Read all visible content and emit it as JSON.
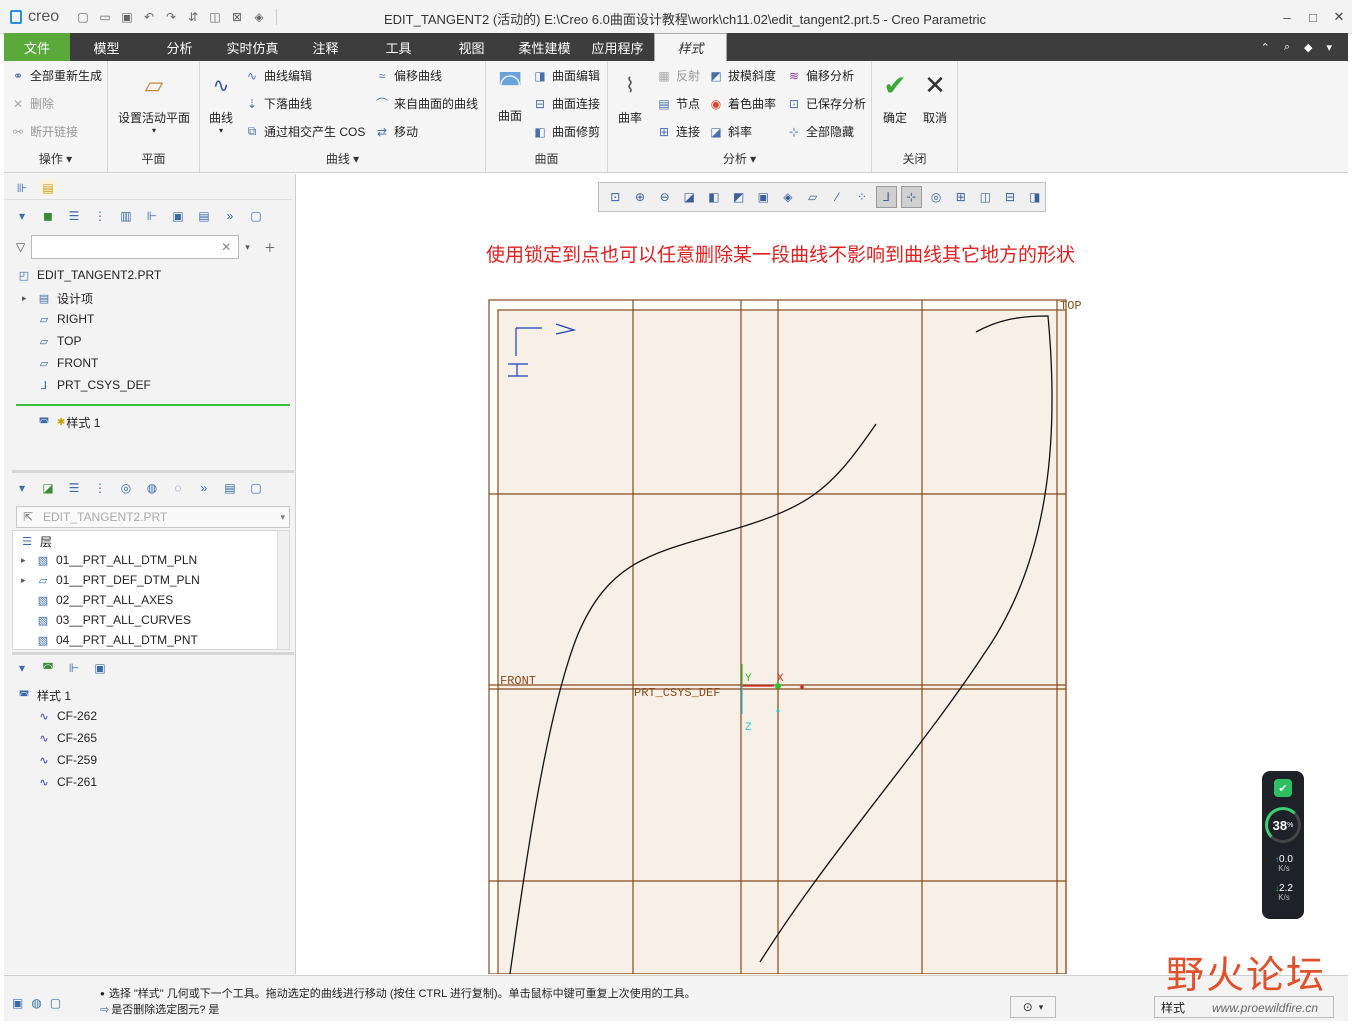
{
  "titlebar": {
    "logo": "creo",
    "title": "EDIT_TANGENT2 (活动的) E:\\Creo 6.0曲面设计教程\\work\\ch11.02\\edit_tangent2.prt.5 - Creo Parametric",
    "minimize": "–",
    "maximize": "□",
    "close": "✕"
  },
  "tabs": [
    "文件",
    "模型",
    "分析",
    "实时仿真",
    "注释",
    "工具",
    "视图",
    "柔性建模",
    "应用程序",
    "样式"
  ],
  "ribbon": {
    "ops": {
      "regen": "全部重新生成",
      "delete": "删除",
      "unlink": "断开链接",
      "label": "操作"
    },
    "plane": {
      "set_active": "设置活动平面",
      "label": "平面"
    },
    "curves": {
      "curve": "曲线",
      "edit": "曲线编辑",
      "drop": "下落曲线",
      "cos": "通过相交产生 COS",
      "offset": "偏移曲线",
      "from_surface": "来自曲面的曲线",
      "move": "移动",
      "label": "曲线"
    },
    "surface": {
      "surface": "曲面",
      "edit": "曲面编辑",
      "connect": "曲面连接",
      "trim": "曲面修剪",
      "label": "曲面"
    },
    "analysis": {
      "curvature": "曲率",
      "reflect": "反射",
      "draft": "拔模斜度",
      "offset_analysis": "偏移分析",
      "node": "节点",
      "shade_curv": "着色曲率",
      "saved": "已保存分析",
      "connect": "连接",
      "slope": "斜率",
      "hide_all": "全部隐藏",
      "label": "分析"
    },
    "close": {
      "ok": "确定",
      "cancel": "取消",
      "label": "关闭"
    }
  },
  "model_tree": {
    "root": "EDIT_TANGENT2.PRT",
    "items": [
      "设计项",
      "RIGHT",
      "TOP",
      "FRONT",
      "PRT_CSYS_DEF"
    ],
    "style_feature": "样式 1",
    "filter_placeholder": ""
  },
  "layers": {
    "model": "EDIT_TANGENT2.PRT",
    "header": "层",
    "items": [
      "01__PRT_ALL_DTM_PLN",
      "01__PRT_DEF_DTM_PLN",
      "02__PRT_ALL_AXES",
      "03__PRT_ALL_CURVES",
      "04__PRT_ALL_DTM_PNT"
    ]
  },
  "style_tree": {
    "root": "样式 1",
    "items": [
      "CF-262",
      "CF-265",
      "CF-259",
      "CF-261"
    ]
  },
  "graphics": {
    "note": "使用锁定到点也可以任意删除某一段曲线不影响到曲线其它地方的形状",
    "label_top": "TOP",
    "label_front": "FRONT",
    "label_csys": "PRT_CSYS_DEF",
    "axis_x": "X",
    "axis_y": "Y",
    "axis_z": "Z",
    "colors": {
      "datum": "#8a4a1c",
      "grid_fill": "#f7f0e6",
      "note": "#e02020",
      "tab_bar": "#3d3d3d",
      "file_tab": "#59a93b"
    }
  },
  "status": {
    "line1": "选择 \"样式\" 几何或下一个工具。拖动选定的曲线进行移动 (按住 CTRL 进行复制)。单击鼠标中键可重复上次使用的工具。",
    "line2": "是否删除选定图元?  是",
    "selector": "样式"
  },
  "monitor": {
    "percent": "38",
    "pct_sign": "%",
    "up": "0.0",
    "down": "2.2",
    "unit": "K/s"
  },
  "watermark": {
    "text": "野火论坛",
    "url": "www.proewildfire.cn"
  }
}
